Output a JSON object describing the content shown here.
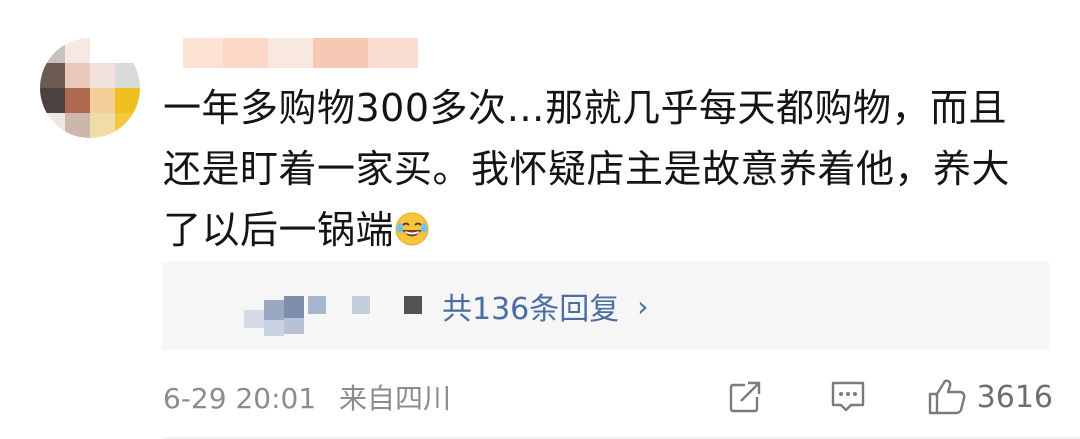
{
  "comment": {
    "text_line1": "一年多购物300多次…那就几乎每天都购物，而且",
    "text_line2": "还是盯着一家买。我怀疑店主是故意养着他，养大",
    "text_line3": "了以后一锅端",
    "emoji": "laughing-tears-emoji"
  },
  "replies": {
    "count_label": "共136条回复",
    "chevron": "›"
  },
  "footer": {
    "time": "6-29 20:01",
    "location": "来自四川",
    "like_count": "3616"
  },
  "colors": {
    "link_blue": "#4a6da3",
    "meta_gray": "#8c8c8c",
    "reply_bg": "#f6f6f6",
    "text": "#141414"
  },
  "icons": [
    "share-icon",
    "comment-icon",
    "like-icon"
  ]
}
